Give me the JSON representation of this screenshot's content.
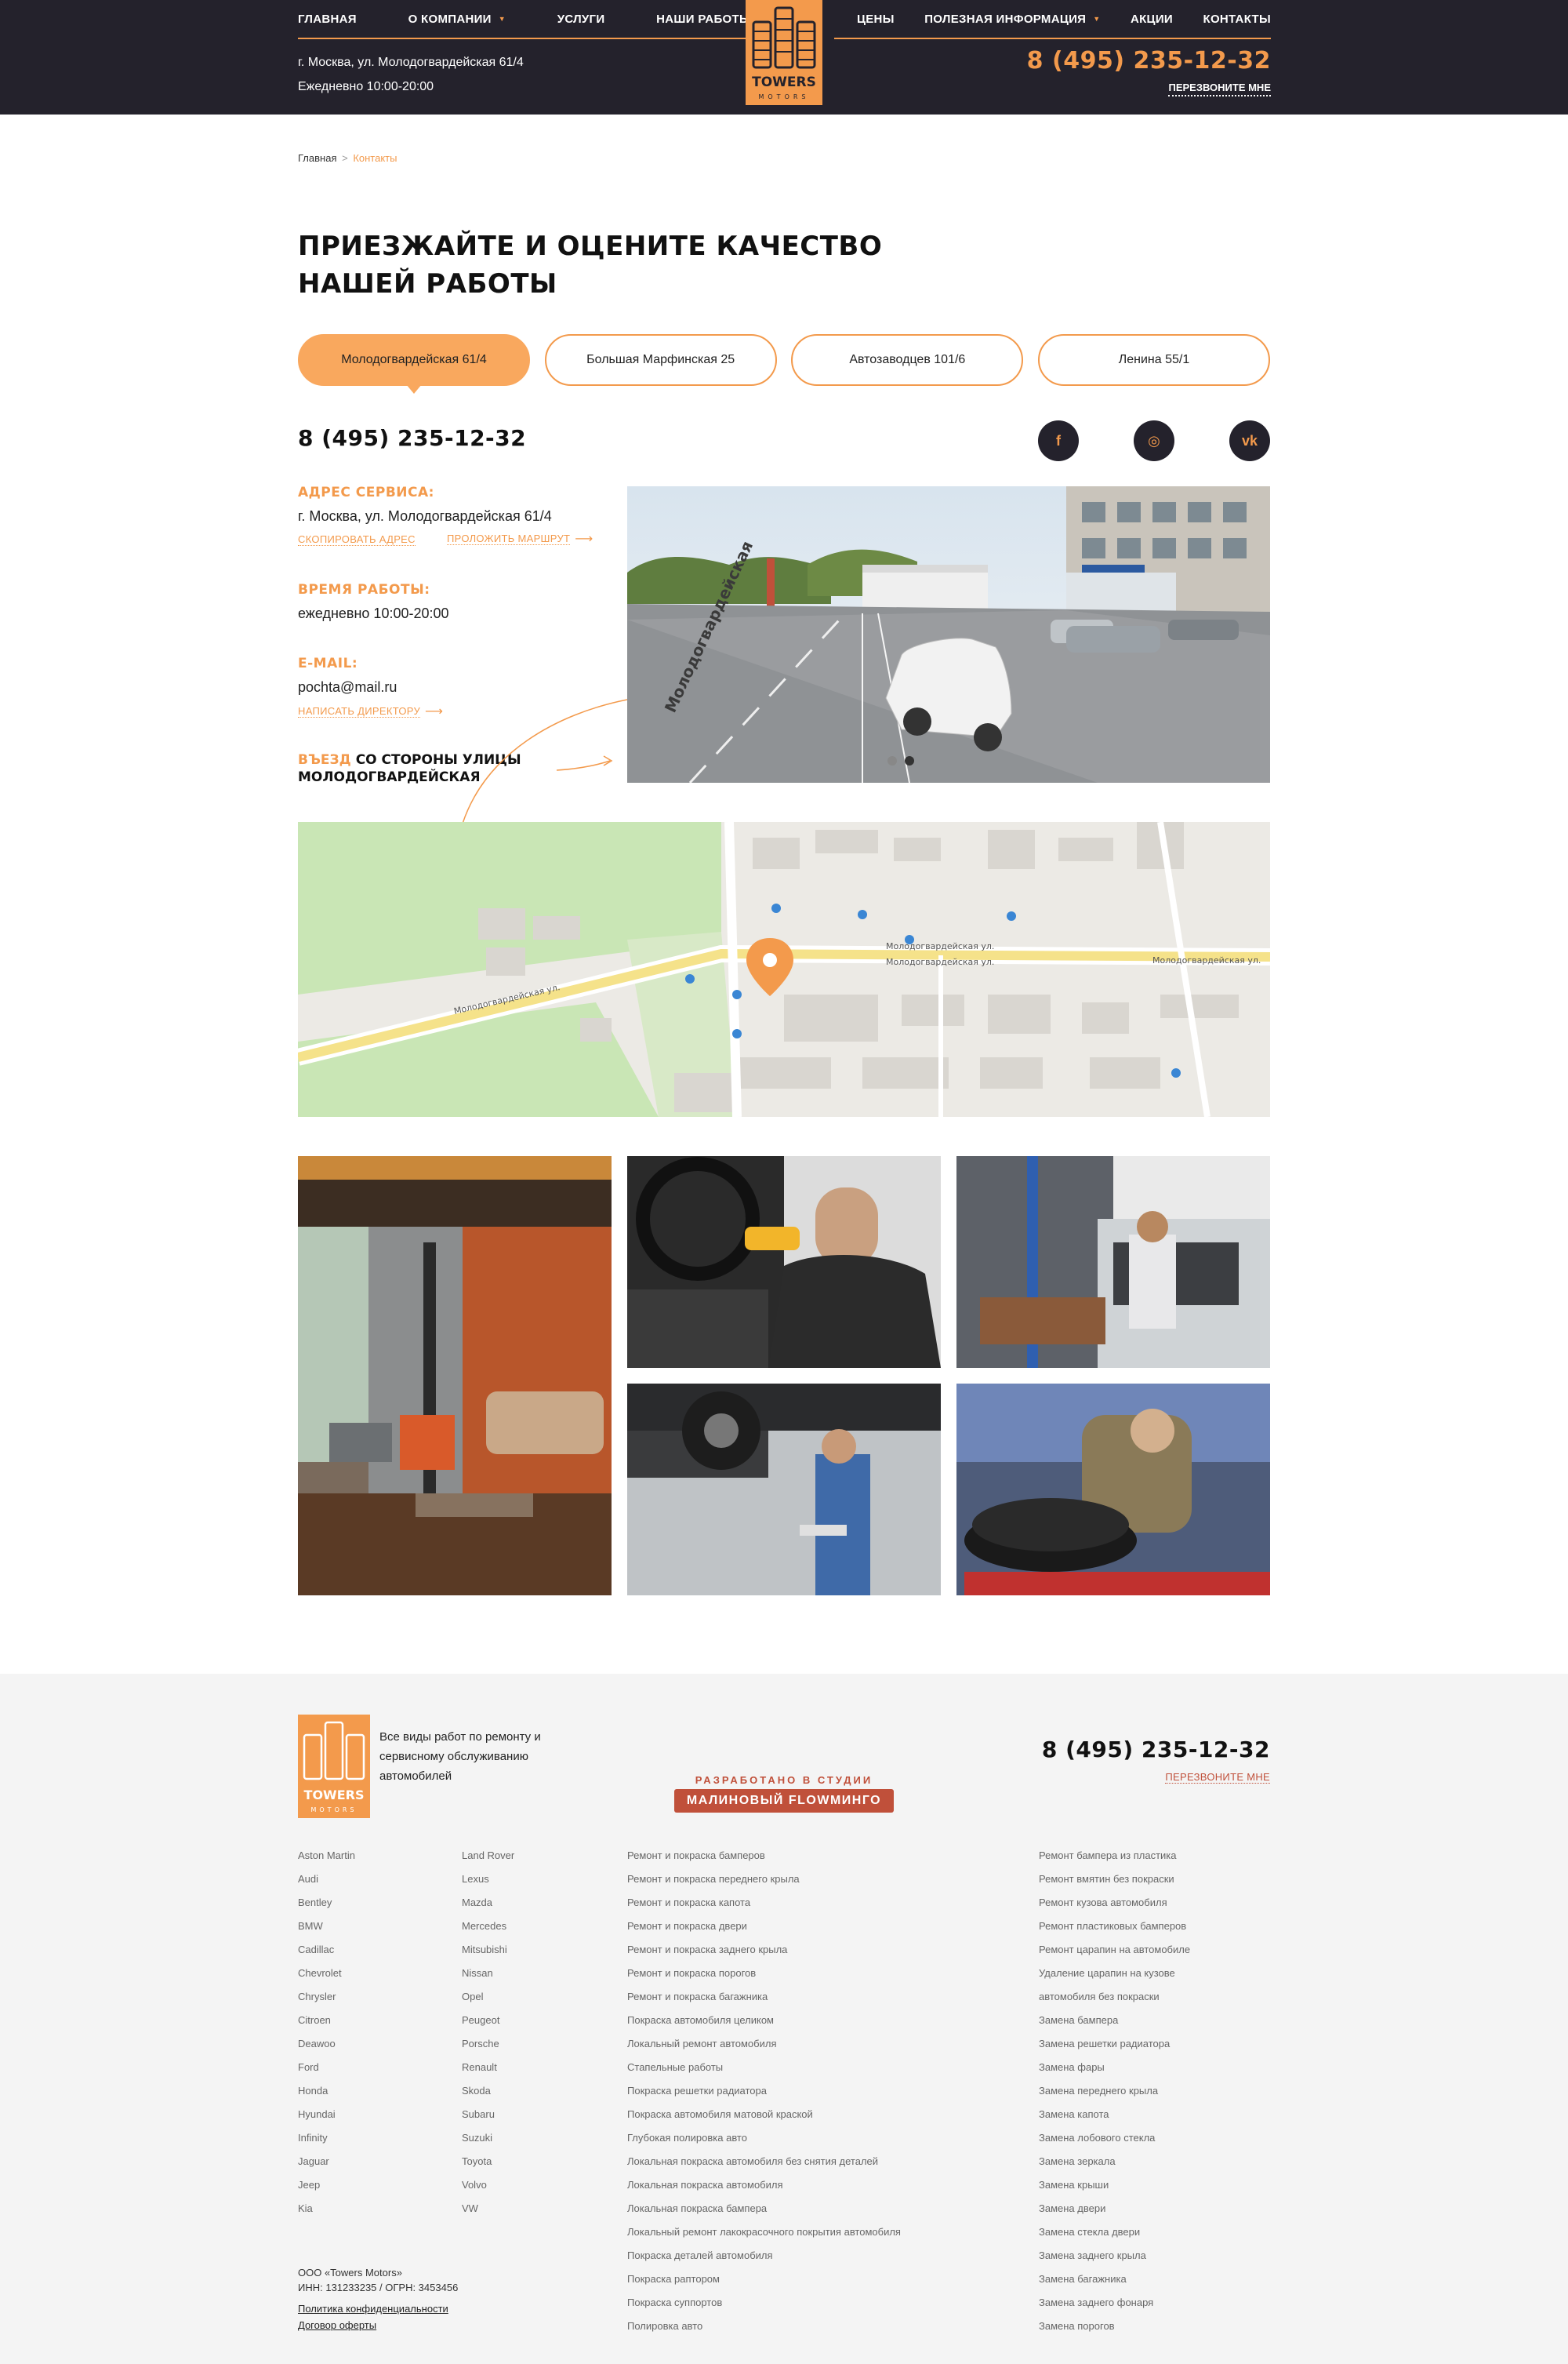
{
  "header": {
    "nav_left": [
      {
        "label": "ГЛАВНАЯ",
        "caret": false
      },
      {
        "label": "О КОМПАНИИ",
        "caret": true
      },
      {
        "label": "УСЛУГИ",
        "caret": false
      },
      {
        "label": "НАШИ РАБОТЫ",
        "caret": false
      }
    ],
    "nav_right": [
      {
        "label": "ЦЕНЫ",
        "caret": false
      },
      {
        "label": "ПОЛЕЗНАЯ ИНФОРМАЦИЯ",
        "caret": true
      },
      {
        "label": "АКЦИИ",
        "caret": false
      },
      {
        "label": "КОНТАКТЫ",
        "caret": false
      }
    ],
    "address": "г. Москва, ул. Молодогвардейская 61/4",
    "hours": "Ежедневно 10:00-20:00",
    "phone": "8 (495) 235-12-32",
    "callback": "ПЕРЕЗВОНИТЕ МНЕ",
    "logo_text": "TOWERS",
    "logo_sub": "MOTORS"
  },
  "breadcrumb": {
    "home": "Главная",
    "separator": ">",
    "current": "Контакты"
  },
  "title": "ПРИЕЗЖАЙТЕ И ОЦЕНИТЕ КАЧЕСТВО НАШЕЙ РАБОТЫ",
  "tabs": [
    {
      "label": "Молодогвардейская 61/4",
      "active": true
    },
    {
      "label": "Большая Марфинская 25",
      "active": false
    },
    {
      "label": "Автозаводцев 101/6",
      "active": false
    },
    {
      "label": "Ленина 55/1",
      "active": false
    }
  ],
  "contact": {
    "phone": "8 (495) 235-12-32",
    "socials": [
      {
        "name": "facebook-icon",
        "glyph": "f"
      },
      {
        "name": "instagram-icon",
        "glyph": "◎"
      },
      {
        "name": "vk-icon",
        "glyph": "vk"
      }
    ],
    "address_label": "АДРЕС СЕРВИСА:",
    "address": "г. Москва, ул. Молодогвардейская 61/4",
    "copy_address": "СКОПИРОВАТЬ АДРЕС",
    "route": "ПРОЛОЖИТЬ МАРШРУТ",
    "hours_label": "ВРЕМЯ РАБОТЫ:",
    "hours": "ежедневно 10:00-20:00",
    "email_label": "E-MAIL:",
    "email": "pochta@mail.ru",
    "write_director": "НАПИСАТЬ ДИРЕКТОРУ",
    "entry_highlight": "ВЪЕЗД",
    "entry_rest": "СО СТОРОНЫ УЛИЦЫ МОЛОДОГВАРДЕЙСКАЯ",
    "street_sign": "Молодогвардейская"
  },
  "map": {
    "street_labels": [
      "Молодогвардейская ул.",
      "Молодогвардейская ул.",
      "Молодогвардейская ул.",
      "Молодогвардейская ул."
    ]
  },
  "footer": {
    "tagline": "Все виды работ по ремонту и сервисному обслуживанию автомобилей",
    "studio_line1": "РАЗРАБОТАНО В СТУДИИ",
    "studio_line2": "МАЛИНОВЫЙ FLOWМИНГО",
    "phone": "8 (495) 235-12-32",
    "callback": "ПЕРЕЗВОНИТЕ МНЕ",
    "brands_col1": [
      "Aston Martin",
      "Audi",
      "Bentley",
      "BMW",
      "Cadillac",
      "Chevrolet",
      "Chrysler",
      "Citroen",
      "Deawoo",
      "Ford",
      "Honda",
      "Hyundai",
      "Infinity",
      "Jaguar",
      "Jeep",
      "Kia"
    ],
    "brands_col2": [
      "Land Rover",
      "Lexus",
      "Mazda",
      "Mercedes",
      "Mitsubishi",
      "Nissan",
      "Opel",
      "Peugeot",
      "Porsche",
      "Renault",
      "Skoda",
      "Subaru",
      "Suzuki",
      "Toyota",
      "Volvo",
      "VW"
    ],
    "services_col1": [
      "Ремонт и покраска бамперов",
      "Ремонт и покраска переднего крыла",
      "Ремонт и покраска капота",
      "Ремонт и покраска двери",
      "Ремонт и покраска заднего крыла",
      "Ремонт и покраска порогов",
      "Ремонт и покраска багажника",
      "Покраска автомобиля целиком",
      "Локальный ремонт автомобиля",
      "Стапельные работы",
      "Покраска решетки радиатора",
      "Покраска автомобиля матовой краской",
      "Глубокая полировка авто",
      "Локальная покраска автомобиля без снятия деталей",
      "Локальная покраска автомобиля",
      "Локальная покраска бампера",
      "Локальный ремонт лакокрасочного покрытия автомобиля",
      "Покраска деталей автомобиля",
      "Покраска раптором",
      "Покраска суппортов",
      "Полировка авто"
    ],
    "services_col2": [
      "Ремонт бампера из пластика",
      "Ремонт вмятин без покраски",
      "Ремонт кузова автомобиля",
      "Ремонт пластиковых бамперов",
      "Ремонт царапин на автомобиле",
      "Удаление царапин на кузове",
      "автомобиля без покраски",
      "Замена бампера",
      "Замена решетки радиатора",
      "Замена фары",
      "Замена переднего крыла",
      "Замена капота",
      "Замена лобового стекла",
      "Замена зеркала",
      "Замена крыши",
      "Замена двери",
      "Замена стекла двери",
      "Замена заднего крыла",
      "Замена багажника",
      "Замена заднего фонаря",
      "Замена порогов"
    ],
    "company": "ООО «Towers Motors»",
    "requisites": "ИНН: 131233235 / ОГРН: 3453456",
    "privacy": "Политика конфиденциальности",
    "offer": "Договор оферты"
  },
  "colors": {
    "accent": "#f39a4c",
    "dark": "#24222c",
    "studio": "#c0503a"
  }
}
